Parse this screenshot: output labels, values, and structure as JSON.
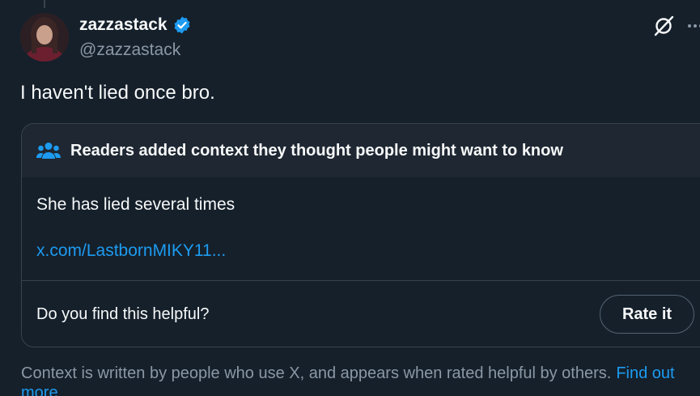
{
  "author": {
    "display_name": "zazzastack",
    "handle": "@zazzastack",
    "verified": true,
    "verified_color": "#1d9bf0"
  },
  "tweet": {
    "text": "I haven't lied once bro."
  },
  "community_note": {
    "title": "Readers added context they thought people might want to know",
    "body": "She has lied several times",
    "link_text": "x.com/LastbornMIKY11...",
    "helpful_prompt": "Do you find this helpful?",
    "rate_button_label": "Rate it"
  },
  "footer": {
    "disclaimer": "Context is written by people who use X, and appears when rated helpful by others.",
    "link_text": "Find out more"
  },
  "icons": {
    "verified": "verified-badge-icon",
    "grok": "grok-icon",
    "more": "more-horizontal-icon",
    "people": "people-icon"
  },
  "colors": {
    "background": "#15202b",
    "accent": "#1d9bf0",
    "secondary_text": "#8b98a5",
    "border": "#38444d"
  }
}
